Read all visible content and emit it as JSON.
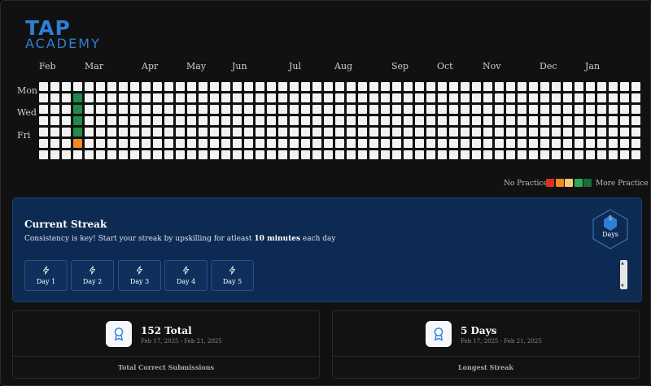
{
  "brand": {
    "line1": "TAP",
    "line2": "ACADEMY"
  },
  "heatmap": {
    "months": [
      "Feb",
      "Mar",
      "Apr",
      "May",
      "Jun",
      "Jul",
      "Aug",
      "Sep",
      "Oct",
      "Nov",
      "Dec",
      "Jan"
    ],
    "day_labels": [
      "Mon",
      "Wed",
      "Fri"
    ],
    "week_count": 53,
    "active_cells": [
      {
        "week": 3,
        "day": 1,
        "level": "green"
      },
      {
        "week": 3,
        "day": 2,
        "level": "green"
      },
      {
        "week": 3,
        "day": 3,
        "level": "green"
      },
      {
        "week": 3,
        "day": 4,
        "level": "green"
      },
      {
        "week": 3,
        "day": 5,
        "level": "orange"
      }
    ]
  },
  "legend": {
    "no_practice": "No Practice",
    "more_practice": "More Practice",
    "colors": [
      "#d9311f",
      "#f08a1c",
      "#f5c97a",
      "#2fa85a",
      "#1a6b3a"
    ]
  },
  "streak": {
    "title": "Current Streak",
    "description_prefix": "Consistency is key! Start your streak by upskilling for atleast ",
    "description_bold": "10 minutes",
    "description_suffix": " each day",
    "days_value": "5",
    "days_label": "Days",
    "day_items": [
      "Day 1",
      "Day 2",
      "Day 3",
      "Day 4",
      "Day 5"
    ]
  },
  "stats": [
    {
      "value": "152 Total",
      "range": "Feb 17, 2025 - Feb 21, 2025",
      "label": "Total Correct Submissions"
    },
    {
      "value": "5 Days",
      "range": "Feb 17, 2025 - Feb 21, 2025",
      "label": "Longest Streak"
    }
  ],
  "colors": {
    "accent": "#2f7fd6",
    "streak_bg": "#0d2a52",
    "cell_empty": "#f2f2f2",
    "green": "#1f8a4c",
    "orange": "#f08a1c"
  }
}
